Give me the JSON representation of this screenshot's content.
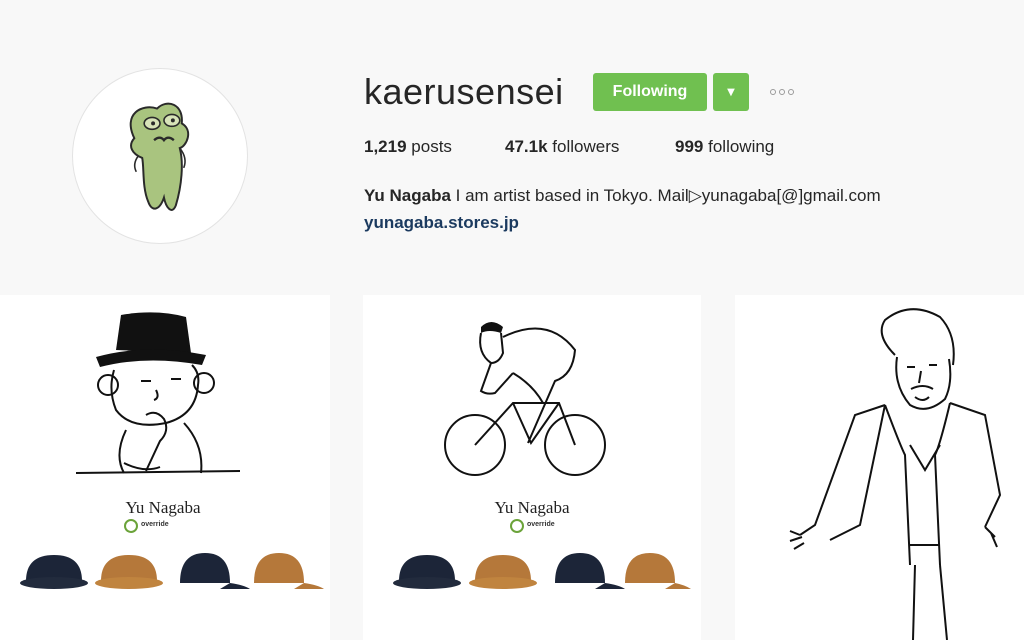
{
  "profile": {
    "username": "kaerusensei",
    "follow_button": "Following",
    "dropdown_icon": "caret-down-icon",
    "more_icon": "more-options-icon",
    "avatar_icon": "frog-avatar-icon",
    "stats": {
      "posts_count": "1,219",
      "posts_label": "posts",
      "followers_count": "47.1k",
      "followers_label": "followers",
      "following_count": "999",
      "following_label": "following"
    },
    "bio": {
      "name": "Yu Nagaba",
      "text": " I am artist based in Tokyo. Mail▷yunagaba[@]gmail.com"
    },
    "website": "yunagaba.stores.jp"
  },
  "posts": [
    {
      "caption": "Yu Nagaba",
      "brand": "override"
    },
    {
      "caption": "Yu Nagaba",
      "brand": "override"
    },
    {
      "caption": ""
    }
  ],
  "colors": {
    "background": "#f8f8f8",
    "follow_green": "#70c050",
    "link_navy": "#1b3a5f",
    "text": "#262626"
  }
}
